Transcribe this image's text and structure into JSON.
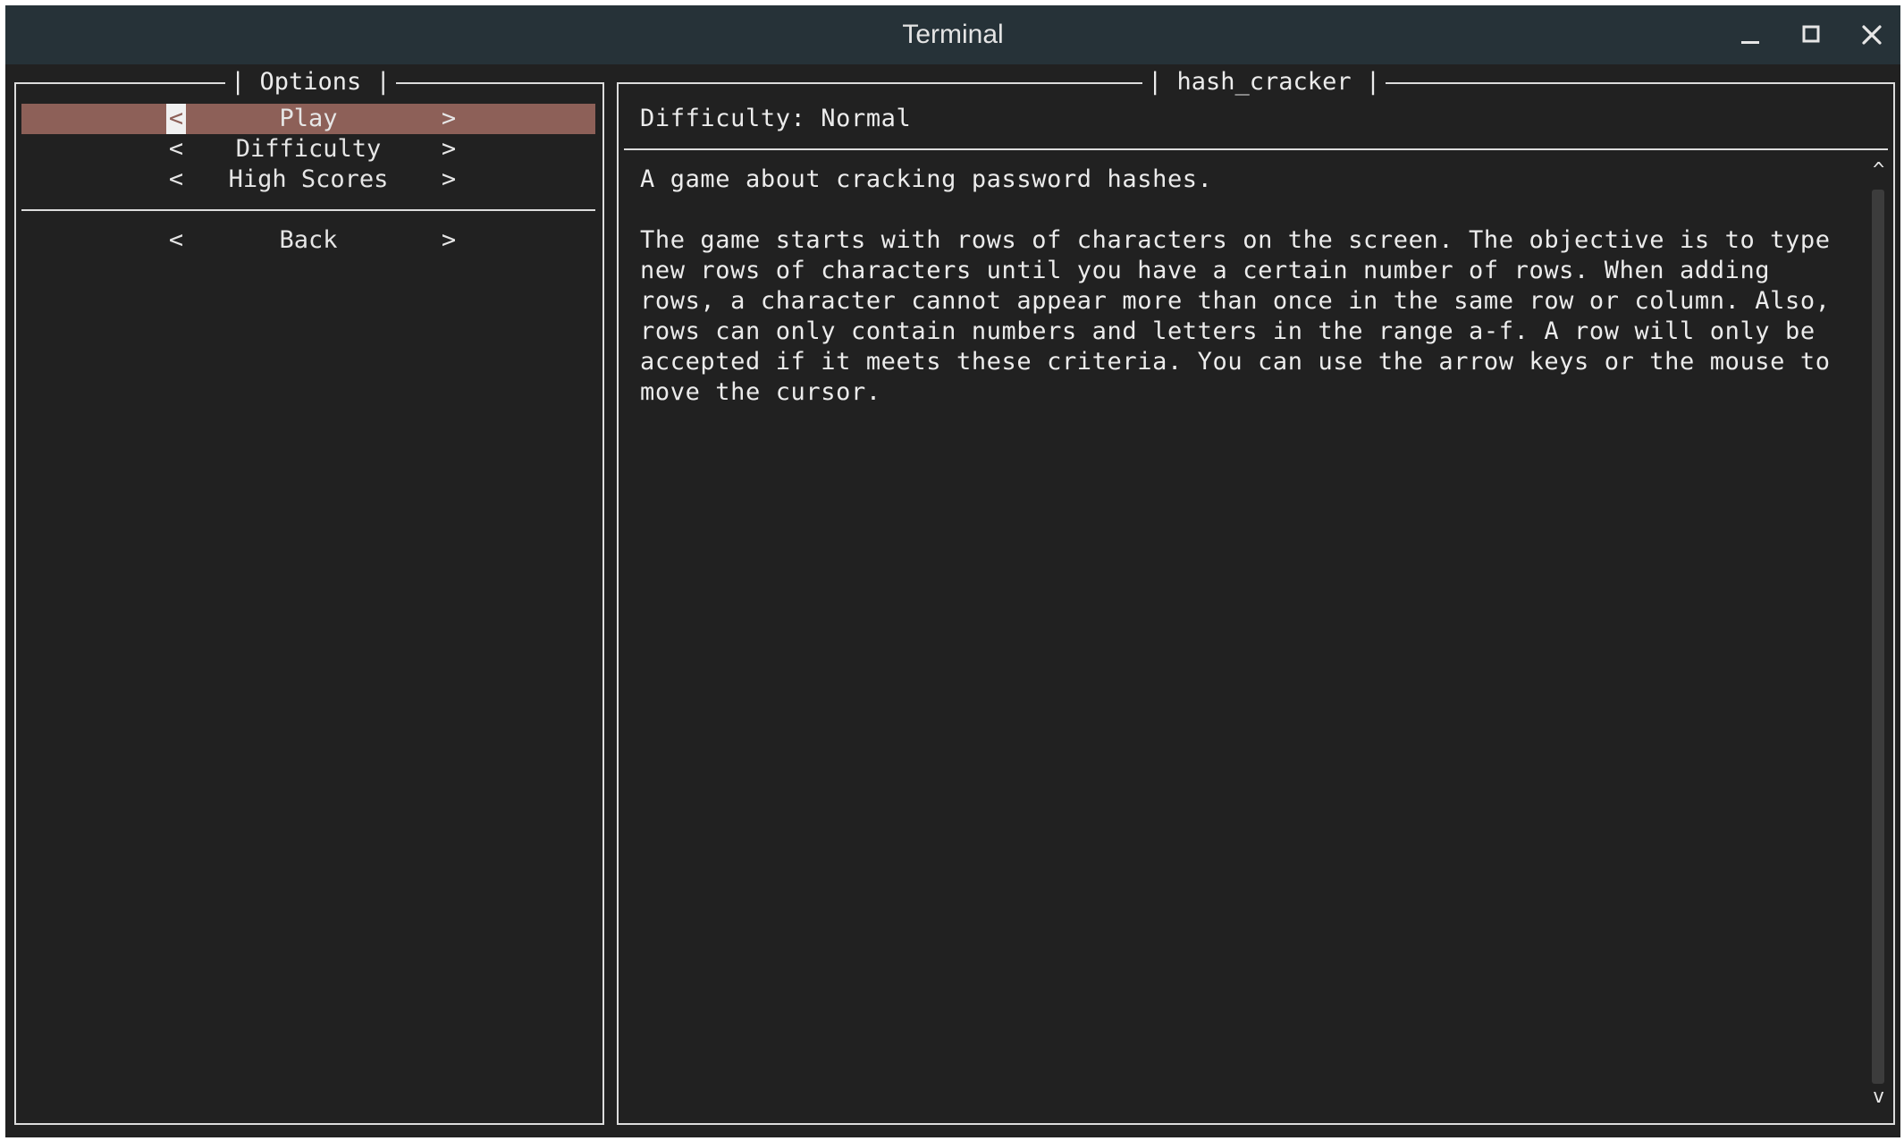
{
  "window": {
    "title": "Terminal",
    "controls": {
      "minimize": "minimize-icon",
      "maximize": "maximize-icon",
      "close": "close-icon"
    }
  },
  "options_panel": {
    "title": "| Options |",
    "menu": [
      {
        "label": "Play",
        "left": "<",
        "right": ">",
        "selected": true
      },
      {
        "label": "Difficulty",
        "left": "<",
        "right": ">"
      },
      {
        "label": "High Scores",
        "left": "<",
        "right": ">"
      }
    ],
    "back": {
      "label": "Back",
      "left": "<",
      "right": ">"
    }
  },
  "game_panel": {
    "title": "| hash_cracker |",
    "difficulty_line": "Difficulty: Normal",
    "description": [
      "A game about cracking password hashes.",
      "",
      "The game starts with rows of characters on the screen. The objective is to type",
      "new rows of characters until you have a certain number of rows. When adding",
      "rows, a character cannot appear more than once in the same row or column. Also,",
      "rows can only contain numbers and letters in the range a-f. A row will only be",
      "accepted if it meets these criteria. You can use the arrow keys or the mouse to",
      "move the cursor."
    ],
    "scroll_up": "^",
    "scroll_down": "v"
  },
  "colors": {
    "titlebar": "#263238",
    "background": "#212121",
    "selection": "#8d6058",
    "border": "#dcdcdc"
  }
}
